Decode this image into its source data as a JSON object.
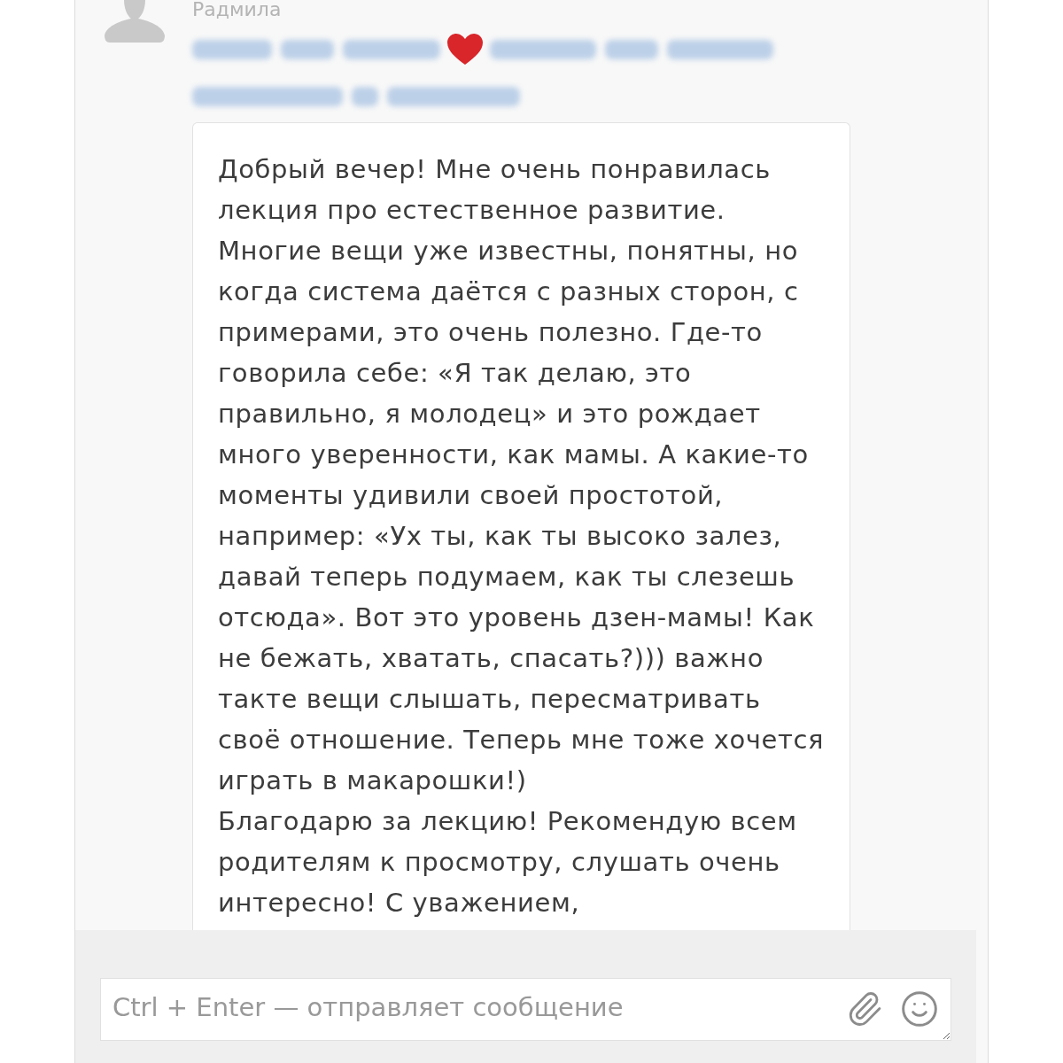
{
  "sender": {
    "name": "Радмила"
  },
  "message": {
    "paragraphs": [
      "Добрый вечер! Мне очень понравилась лекция про естественное развитие. Многие вещи уже известны, понятны, но когда система даётся с разных сторон, с примерами, это очень полезно. Где-то говорила себе: «Я так делаю, это правильно, я молодец» и это рождает много уверенности, как мамы. А какие-то моменты удивили своей простотой, например: «Ух ты, как ты высоко залез, давай теперь подумаем, как ты слезешь отсюда». Вот это уровень дзен-мамы! Как не бежать, хватать, спасать?))) важно такте вещи слышать, пересматривать своё отношение. Теперь мне тоже хочется играть в макарошки!)",
      "Благодарю за лекцию! Рекомендую всем родителям к просмотру, слушать очень интересно! С уважением,"
    ]
  },
  "composer": {
    "placeholder": "Ctrl + Enter — отправляет сообщение"
  }
}
